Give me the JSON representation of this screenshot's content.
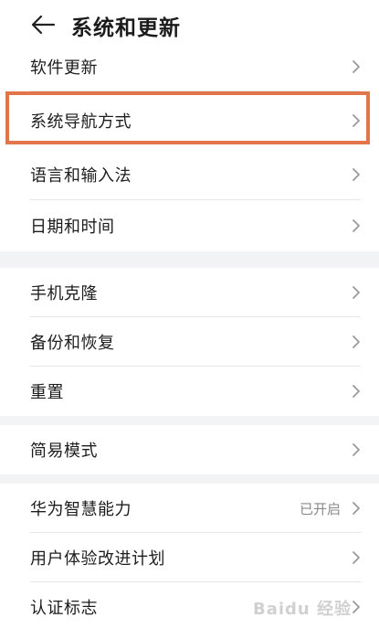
{
  "header": {
    "title": "系统和更新"
  },
  "groups": [
    {
      "items": [
        {
          "label": "软件更新"
        },
        {
          "label": "系统导航方式"
        },
        {
          "label": "语言和输入法"
        },
        {
          "label": "日期和时间"
        }
      ]
    },
    {
      "items": [
        {
          "label": "手机克隆"
        },
        {
          "label": "备份和恢复"
        },
        {
          "label": "重置"
        }
      ]
    },
    {
      "items": [
        {
          "label": "简易模式"
        }
      ]
    },
    {
      "items": [
        {
          "label": "华为智慧能力",
          "status": "已开启"
        },
        {
          "label": "用户体验改进计划"
        },
        {
          "label": "认证标志"
        }
      ]
    }
  ],
  "watermark": "Baidu 经验",
  "colors": {
    "highlight": "#e2754a",
    "chevron": "#9a9a9a"
  },
  "icons": {
    "back": "arrow-left-icon",
    "chevron": "chevron-right-icon"
  }
}
